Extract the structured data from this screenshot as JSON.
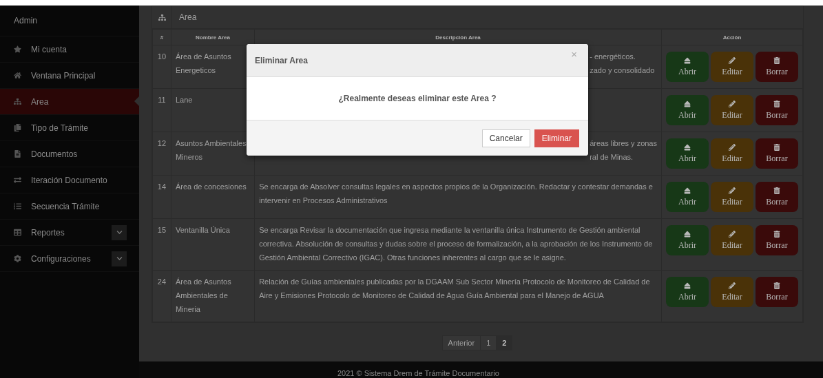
{
  "sidebar": {
    "title": "Admin",
    "items": [
      {
        "label": "Mi cuenta",
        "kind": "link",
        "selected": false
      },
      {
        "label": "Ventana Principal",
        "kind": "link",
        "selected": false
      },
      {
        "label": "Area",
        "kind": "link",
        "selected": true
      },
      {
        "label": "Tipo de Trámite",
        "kind": "link",
        "selected": false
      },
      {
        "label": "Documentos",
        "kind": "link",
        "selected": false
      },
      {
        "label": "Iteración Documento",
        "kind": "link",
        "selected": false
      },
      {
        "label": "Secuencia Trámite",
        "kind": "link",
        "selected": false
      },
      {
        "label": "Reportes",
        "kind": "group",
        "selected": false,
        "expanded": false
      },
      {
        "label": "Configuraciones",
        "kind": "group",
        "selected": false,
        "expanded": false
      }
    ]
  },
  "panel": {
    "title": "Area"
  },
  "table": {
    "columns": [
      "#",
      "Nombre Area",
      "Descripción Area",
      "Acción"
    ],
    "rows": [
      {
        "number": "10",
        "name": "Área de Asuntos Energeticos",
        "description": {
          "kind": "partial",
          "lines": [
            "- energéticos.",
            "zado y consolidado"
          ]
        },
        "actions": [
          "Abrir",
          "Editar",
          "Borrar"
        ]
      },
      {
        "number": "11",
        "name": "Lane",
        "actions": [
          "Abrir",
          "Editar",
          "Borrar"
        ]
      },
      {
        "number": "12",
        "name": "Asuntos Ambientales Mineros",
        "description": {
          "kind": "partial",
          "lines": [
            "áreas libres y zonas",
            "ral de Minas."
          ]
        },
        "actions": [
          "Abrir",
          "Editar",
          "Borrar"
        ]
      },
      {
        "number": "14",
        "name": "Área de concesiones",
        "description": {
          "kind": "full",
          "text": "Se encarga de Absolver consultas legales en aspectos propios de la Organización. Redactar y contestar demandas e intervenir en Procesos Administrativos"
        },
        "actions": [
          "Abrir",
          "Editar",
          "Borrar"
        ]
      },
      {
        "number": "15",
        "name": "Ventanilla Única",
        "description": {
          "kind": "full",
          "text": "Se encarga Revisar la documentación que ingresa mediante la ventanilla única Instrumento de Gestión ambiental correctiva. Absolución de consultas y dudas sobre el proceso de formalización, a la aprobación de los Instrumento de Gestión Ambiental Correctivo (IGAC). Otras funciones inherentes al cargo que se le asigne."
        },
        "actions": [
          "Abrir",
          "Editar",
          "Borrar"
        ]
      },
      {
        "number": "24",
        "name": "Área de Asuntos Ambientales de Mineria",
        "description": {
          "kind": "full",
          "text": "Relación de Guías ambientales publicadas por la DGAAM Sub Sector Minería Protocolo de Monitoreo de Calidad de Aire y Emisiones Protocolo de Monitoreo de Calidad de Agua Guía Ambiental para el Manejo de AGUA"
        },
        "actions": [
          "Abrir",
          "Editar",
          "Borrar"
        ]
      }
    ]
  },
  "pagination": [
    {
      "label": "Anterior",
      "selected": false
    },
    {
      "label": "1",
      "selected": false
    },
    {
      "label": "2",
      "selected": true
    }
  ],
  "footer": "2021 © Sistema Drem de Trámite Documentario",
  "modal": {
    "title": "Eliminar Area",
    "close": "×",
    "message": "¿Realmente deseas eliminar este Area ?",
    "buttons": [
      {
        "label": "Cancelar",
        "kind": "default"
      },
      {
        "label": "Eliminar",
        "kind": "danger"
      }
    ]
  }
}
